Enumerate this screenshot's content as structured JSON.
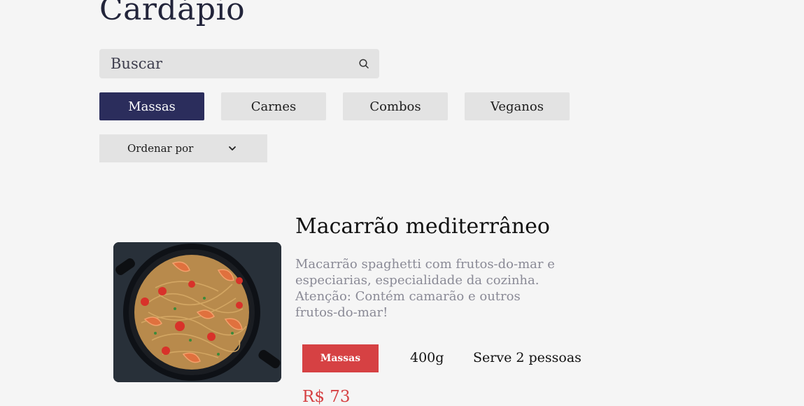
{
  "page": {
    "title": "Cardápio"
  },
  "search": {
    "placeholder": "Buscar",
    "icon": "search-icon"
  },
  "categories": [
    {
      "label": "Massas",
      "active": true
    },
    {
      "label": "Carnes",
      "active": false
    },
    {
      "label": "Combos",
      "active": false
    },
    {
      "label": "Veganos",
      "active": false
    }
  ],
  "sort": {
    "label": "Ordenar por",
    "icon": "chevron-down-icon"
  },
  "colors": {
    "accent": "#2b2d5c",
    "tag": "#d64143",
    "price": "#d64143"
  },
  "products": [
    {
      "name": "Macarrão mediterrâneo",
      "description": "Macarrão spaghetti com frutos-do-mar e especiarias, especialidade da cozinha. Atenção: Contém camarão e outros frutos-do-mar!",
      "category_tag": "Massas",
      "weight": "400g",
      "serves": "Serve 2 pessoas",
      "price": "R$ 73"
    }
  ]
}
